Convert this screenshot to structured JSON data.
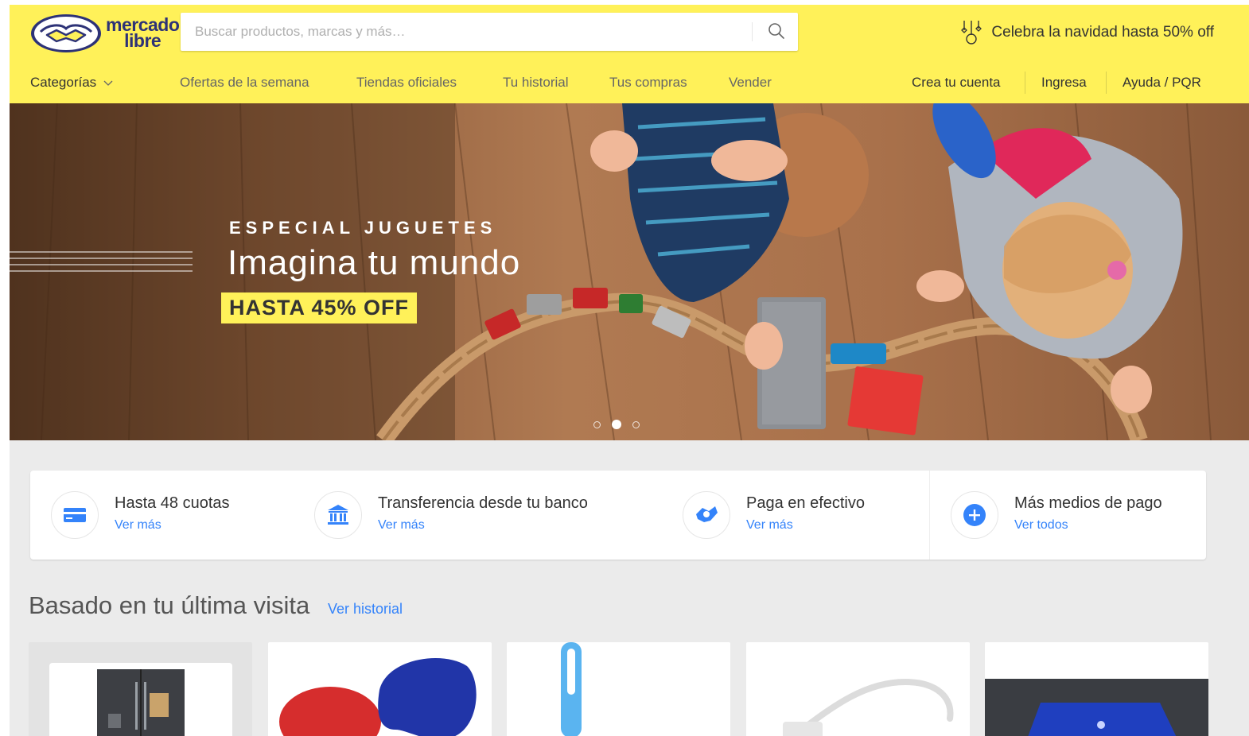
{
  "header": {
    "logo_text": "mercado\nlibre",
    "search_placeholder": "Buscar productos, marcas y más…",
    "promo_text": "Celebra la navidad hasta 50% off",
    "promo_icon": "ornaments-icon",
    "brand_color": "#fff159",
    "brand_text_color": "#2d3277"
  },
  "nav": {
    "categories": "Categorías",
    "links": [
      "Ofertas de la semana",
      "Tiendas oficiales",
      "Tu historial",
      "Tus compras",
      "Vender"
    ],
    "account": [
      "Crea tu cuenta",
      "Ingresa",
      "Ayuda / PQR"
    ]
  },
  "banner": {
    "eyebrow": "ESPECIAL JUGUETES",
    "headline": "Imagina tu mundo",
    "badge": "HASTA 45% OFF",
    "slides": 3,
    "active_slide": 2
  },
  "payments": [
    {
      "icon": "credit-card-icon",
      "title": "Hasta 48 cuotas",
      "link": "Ver más"
    },
    {
      "icon": "bank-icon",
      "title": "Transferencia desde tu banco",
      "link": "Ver más"
    },
    {
      "icon": "cash-payment-icon",
      "title": "Paga en efectivo",
      "link": "Ver más"
    },
    {
      "icon": "plus-circle-icon",
      "title": "Más medios de pago",
      "link": "Ver todos"
    }
  ],
  "recent": {
    "title": "Basado en tu última visita",
    "link": "Ver historial",
    "items": [
      {
        "product": "refrigerator"
      },
      {
        "product": "mouse-pads"
      },
      {
        "product": "usb-led-light"
      },
      {
        "product": "usb-adapter-cable"
      },
      {
        "product": "laptop-case"
      }
    ]
  },
  "colors": {
    "link": "#3483fa",
    "page_bg": "#ebebeb"
  }
}
